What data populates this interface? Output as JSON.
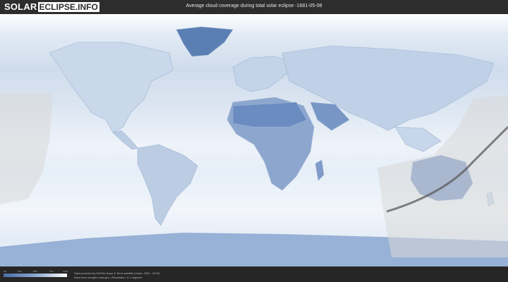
{
  "header": {
    "logo_solar": "SOLAR",
    "logo_rest": "ECLIPSE.INFO",
    "title": "Average cloud coverage during total solar eclipse -1681-05-08"
  },
  "legend": {
    "ticks": [
      "0%",
      "25%",
      "50%",
      "75%",
      "100%"
    ]
  },
  "footer": {
    "credit_line1": "Data provided by NASA's Aqua & Terra satellite (Years: 2000 - 2019)",
    "credit_line2": "https://neo.sci.gsfc.nasa.gov | Resolution: 0.1 degrees"
  },
  "colors": {
    "cloud_clear": "#4a6da8",
    "cloud_full": "#ffffff",
    "eclipse_path": "#5a5a5a"
  }
}
